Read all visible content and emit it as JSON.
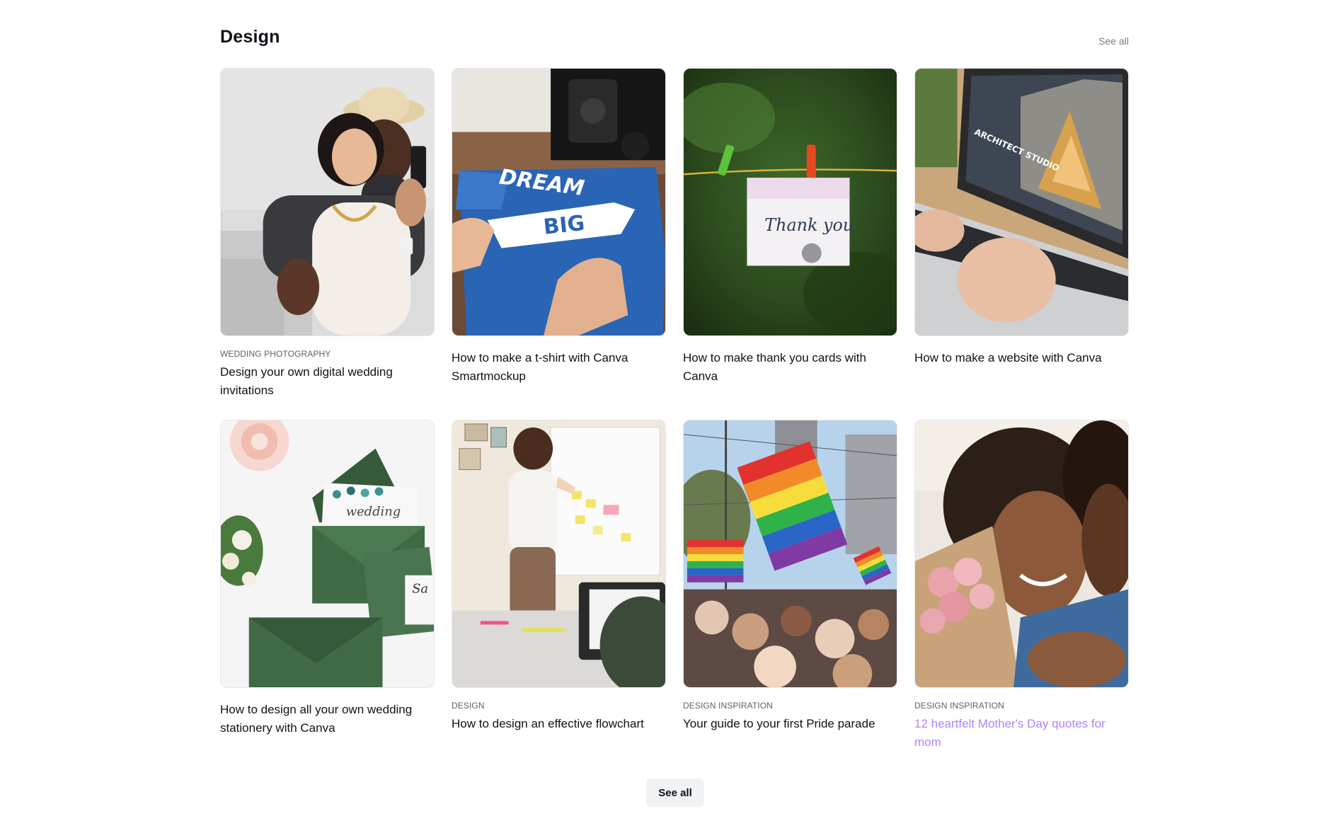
{
  "section": {
    "title": "Design",
    "see_all_top": "See all",
    "see_all_bottom": "See all"
  },
  "cards": [
    {
      "category": "Wedding Photography",
      "title": "Design your own digital wedding invitations",
      "visited": false
    },
    {
      "category": "",
      "title": "How to make a t-shirt with Canva Smartmockup",
      "visited": false
    },
    {
      "category": "",
      "title": "How to make thank you cards with Canva",
      "visited": false
    },
    {
      "category": "",
      "title": "How to make a website with Canva",
      "visited": false
    },
    {
      "category": "",
      "title": "How to design all your own wedding stationery with Canva",
      "visited": false
    },
    {
      "category": "Design",
      "title": "How to design an effective flowchart",
      "visited": false
    },
    {
      "category": "Design Inspiration",
      "title": "Your guide to your first Pride parade",
      "visited": false
    },
    {
      "category": "Design Inspiration",
      "title": "12 heartfelt Mother's Day quotes for mom",
      "visited": true
    }
  ],
  "image_text": {
    "tshirt_line1": "DREAM",
    "tshirt_line2": "BIG",
    "card_note": "Thank you",
    "laptop_label": "ARCHITECT STUDIO",
    "envelope_note": "wedding",
    "envelope_side": "Sa"
  },
  "colors": {
    "link_visited": "#8b3dff",
    "button_bg": "#f1f2f4",
    "muted": "#7a7f87"
  }
}
